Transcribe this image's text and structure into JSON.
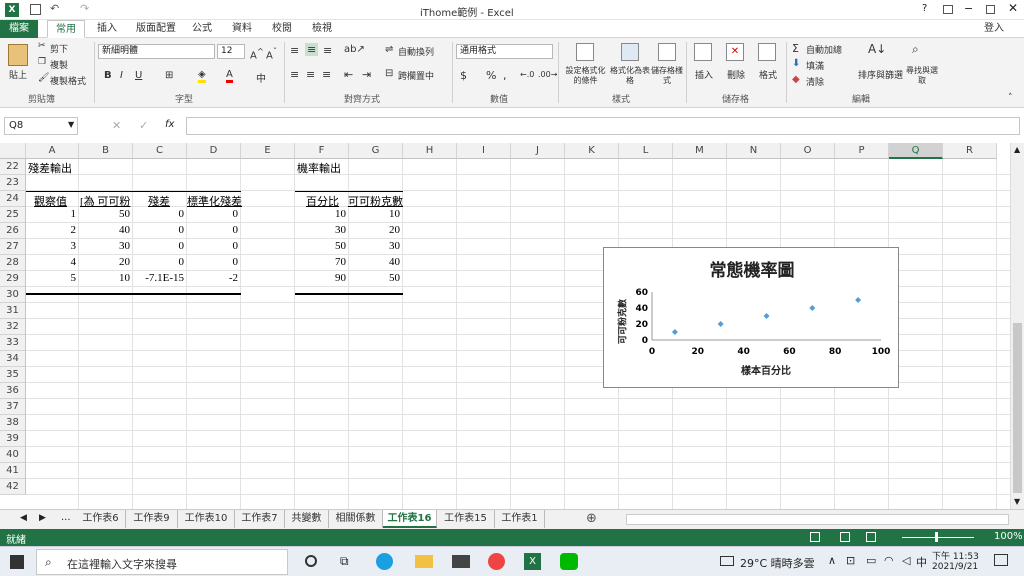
{
  "window": {
    "title": "iThome範例 - Excel",
    "user": "登入",
    "help": "?"
  },
  "tabs": [
    "檔案",
    "常用",
    "插入",
    "版面配置",
    "公式",
    "資料",
    "校閱",
    "檢視"
  ],
  "ribbon": {
    "clipboard": {
      "paste": "貼上",
      "cut": "剪下",
      "copy": "複製",
      "format_painter": "複製格式",
      "label": "剪貼簿"
    },
    "font": {
      "name": "新細明體",
      "size": "12",
      "label": "字型"
    },
    "alignment": {
      "wrap": "自動換列",
      "merge": "跨欄置中",
      "label": "對齊方式"
    },
    "number": {
      "format": "通用格式",
      "label": "數值"
    },
    "styles": {
      "cond": "設定格式化的條件",
      "table": "格式化為表格",
      "cell": "儲存格樣式",
      "label": "樣式"
    },
    "cells": {
      "insert": "插入",
      "delete": "刪除",
      "format": "格式",
      "label": "儲存格"
    },
    "editing": {
      "autosum": "自動加總",
      "fill": "填滿",
      "clear": "清除",
      "sort": "排序與篩選",
      "find": "尋找與選取",
      "label": "編輯"
    }
  },
  "formula_bar": {
    "name_box": "Q8",
    "fx": "fx",
    "formula": ""
  },
  "columns": [
    "A",
    "B",
    "C",
    "D",
    "E",
    "F",
    "G",
    "H",
    "I",
    "J",
    "K",
    "L",
    "M",
    "N",
    "O",
    "P",
    "Q",
    "R"
  ],
  "selected_column": "Q",
  "rows": [
    "22",
    "23",
    "24",
    "25",
    "26",
    "27",
    "28",
    "29",
    "30",
    "31",
    "32",
    "33",
    "34",
    "35",
    "36",
    "37",
    "38",
    "39",
    "40",
    "41",
    "42"
  ],
  "residual": {
    "title": "殘差輸出",
    "headers": [
      "觀察值",
      "[為 可可粉",
      "殘差",
      "標準化殘差"
    ],
    "data": [
      [
        "1",
        "50",
        "0",
        "0"
      ],
      [
        "2",
        "40",
        "0",
        "0"
      ],
      [
        "3",
        "30",
        "0",
        "0"
      ],
      [
        "4",
        "20",
        "0",
        "0"
      ],
      [
        "5",
        "10",
        "-7.1E-15",
        "-2"
      ]
    ]
  },
  "probability": {
    "title": "機率輸出",
    "headers": [
      "百分比",
      "可可粉克數"
    ],
    "data": [
      [
        "10",
        "10"
      ],
      [
        "30",
        "20"
      ],
      [
        "50",
        "30"
      ],
      [
        "70",
        "40"
      ],
      [
        "90",
        "50"
      ]
    ]
  },
  "sheet_tabs": [
    "工作表6",
    "工作表9",
    "工作表10",
    "工作表7",
    "共變數",
    "相關係數",
    "工作表16",
    "工作表15",
    "工作表1"
  ],
  "active_sheet": "工作表16",
  "nav": {
    "ellipsis": "...",
    "plus": "⊕"
  },
  "status": {
    "ready": "就緒",
    "zoom": "100%"
  },
  "taskbar": {
    "search": "在這裡輸入文字來搜尋",
    "weather": "29°C  晴時多雲",
    "ime": "中",
    "time": "下午 11:53",
    "date": "2021/9/21"
  },
  "chart_data": {
    "type": "scatter",
    "title": "常態機率圖",
    "xlabel": "樣本百分比",
    "ylabel": "可可粉克數",
    "xlim": [
      0,
      100
    ],
    "ylim": [
      0,
      60
    ],
    "xticks": [
      "0",
      "20",
      "40",
      "60",
      "80",
      "100"
    ],
    "yticks": [
      "0",
      "20",
      "40",
      "60"
    ],
    "x": [
      10,
      30,
      50,
      70,
      90
    ],
    "y": [
      10,
      20,
      30,
      40,
      50
    ],
    "color": "#5b9bd5"
  }
}
